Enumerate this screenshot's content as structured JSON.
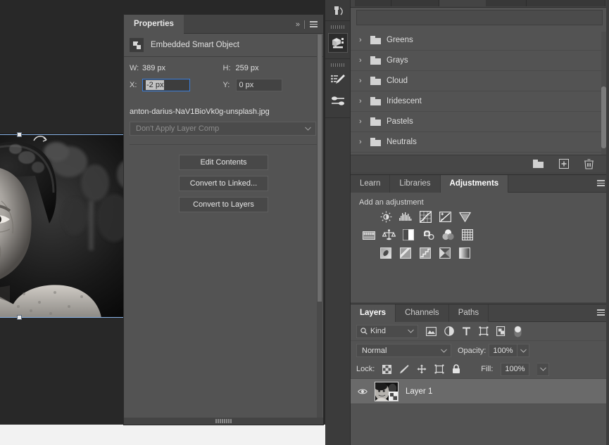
{
  "app": "Adobe Photoshop",
  "properties_panel": {
    "tab_label": "Properties",
    "expand_icon": "double-chevron-right-icon",
    "menu_icon": "panel-menu-icon",
    "object_type": "Embedded Smart Object",
    "object_icon": "smart-object-icon",
    "dimensions": {
      "w_key": "W:",
      "w_value": "389 px",
      "h_key": "H:",
      "h_value": "259 px",
      "x_key": "X:",
      "x_value": "-2 px",
      "x_focused": true,
      "y_key": "Y:",
      "y_value": "0 px"
    },
    "filename": "anton-darius-NaV1BioVk0g-unsplash.jpg",
    "layer_comp": {
      "value": "Don't Apply Layer Comp",
      "chevron": "chevron-down-icon"
    },
    "buttons": [
      {
        "label": "Edit Contents",
        "name": "edit-contents-button"
      },
      {
        "label": "Convert to Linked...",
        "name": "convert-to-linked-button"
      },
      {
        "label": "Convert to Layers",
        "name": "convert-to-layers-button"
      }
    ]
  },
  "tool_strip": {
    "icons": [
      {
        "name": "clone-source-icon",
        "active": false
      },
      {
        "name": "3d-panel-icon",
        "active": true
      },
      {
        "name": "brush-presets-icon",
        "active": false
      },
      {
        "name": "brush-settings-icon",
        "active": false
      }
    ]
  },
  "swatches_panel": {
    "search_placeholder": "",
    "groups": [
      {
        "label": "Greens",
        "icon": "folder-icon",
        "chevron": "chevron-right-icon"
      },
      {
        "label": "Grays",
        "icon": "folder-icon",
        "chevron": "chevron-right-icon"
      },
      {
        "label": "Cloud",
        "icon": "folder-icon",
        "chevron": "chevron-right-icon"
      },
      {
        "label": "Iridescent",
        "icon": "folder-icon",
        "chevron": "chevron-right-icon"
      },
      {
        "label": "Pastels",
        "icon": "folder-icon",
        "chevron": "chevron-right-icon"
      },
      {
        "label": "Neutrals",
        "icon": "folder-icon",
        "chevron": "chevron-right-icon"
      }
    ],
    "footer_icons": [
      {
        "name": "new-group-folder-icon"
      },
      {
        "name": "new-swatch-plus-icon"
      },
      {
        "name": "delete-trash-icon"
      }
    ]
  },
  "adjustments_panel": {
    "tabs": [
      {
        "label": "Learn",
        "active": false,
        "name": "tab-learn"
      },
      {
        "label": "Libraries",
        "active": false,
        "name": "tab-libraries"
      },
      {
        "label": "Adjustments",
        "active": true,
        "name": "tab-adjustments"
      }
    ],
    "menu_icon": "panel-menu-icon",
    "section_label": "Add an adjustment",
    "rows": [
      [
        {
          "name": "brightness-contrast-icon"
        },
        {
          "name": "levels-icon"
        },
        {
          "name": "curves-icon"
        },
        {
          "name": "exposure-icon"
        },
        {
          "name": "vibrance-icon"
        }
      ],
      [
        {
          "name": "hue-saturation-icon"
        },
        {
          "name": "color-balance-icon"
        },
        {
          "name": "black-and-white-icon"
        },
        {
          "name": "photo-filter-icon"
        },
        {
          "name": "channel-mixer-icon"
        },
        {
          "name": "color-lookup-icon"
        }
      ],
      [
        {
          "name": "invert-icon"
        },
        {
          "name": "posterize-icon"
        },
        {
          "name": "threshold-icon"
        },
        {
          "name": "selective-color-icon"
        },
        {
          "name": "gradient-map-icon"
        }
      ]
    ]
  },
  "layers_panel": {
    "tabs": [
      {
        "label": "Layers",
        "active": true,
        "name": "tab-layers"
      },
      {
        "label": "Channels",
        "active": false,
        "name": "tab-channels"
      },
      {
        "label": "Paths",
        "active": false,
        "name": "tab-paths"
      }
    ],
    "menu_icon": "panel-menu-icon",
    "filter": {
      "kind_label": "Kind",
      "search_icon": "search-icon",
      "chevron": "chevron-down-icon",
      "filter_icons": [
        {
          "name": "filter-pixel-icon"
        },
        {
          "name": "filter-adjustment-icon"
        },
        {
          "name": "filter-type-icon"
        },
        {
          "name": "filter-shape-icon"
        },
        {
          "name": "filter-smart-object-icon"
        }
      ],
      "toggle_name": "filter-toggle-switch"
    },
    "blend_mode": "Normal",
    "opacity_label": "Opacity:",
    "opacity_value": "100%",
    "lock_label": "Lock:",
    "lock_icons": [
      {
        "name": "lock-transparent-pixels-icon"
      },
      {
        "name": "lock-image-pixels-icon"
      },
      {
        "name": "lock-position-icon"
      },
      {
        "name": "lock-artboard-nesting-icon"
      },
      {
        "name": "lock-all-icon"
      }
    ],
    "fill_label": "Fill:",
    "fill_value": "100%",
    "rows": [
      {
        "name": "Layer 1",
        "visible": true,
        "eye_icon": "eye-visible-icon",
        "thumb_icon": "smart-object-badge-icon",
        "selected": true
      }
    ]
  },
  "canvas": {
    "image_alt": "black and white portrait of an elderly woman",
    "transform_handles": true
  },
  "colors": {
    "panel_bg": "#535353",
    "dock_bg": "#444444",
    "canvas_bg": "#282828",
    "accent_focus": "#3a7ddb",
    "selection_blue": "#8ab4e8",
    "text": "#dedede",
    "layer_selected": "#6a6a6a"
  }
}
